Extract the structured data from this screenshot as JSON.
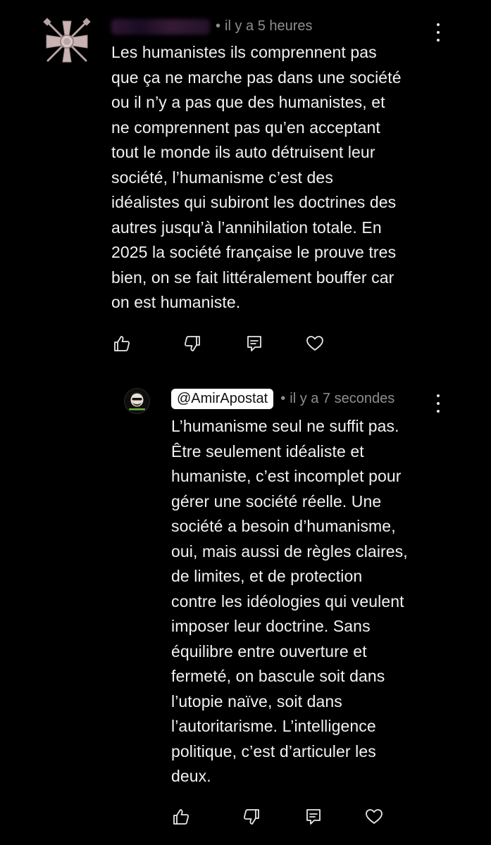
{
  "comments": [
    {
      "author_blurred": true,
      "timestamp": "il y a 5 heures",
      "separator": "•",
      "text": "Les humanistes ils comprennent pas\nque ça ne marche pas dans une société\nou il n’y a pas que des humanistes, et\nne comprennent pas qu’en acceptant\ntout le monde ils auto détruisent leur\nsociété, l’humanisme c’est des\nidéalistes qui subiront les doctrines des\nautres jusqu’à l’annihilation totale. En\n2025 la société française le prouve tres\nbien, on se fait littéralement bouffer car\non est humaniste.",
      "avatar_icon": "war-cross-medal-icon"
    },
    {
      "author": "@AmirApostat",
      "timestamp": "il y a 7 secondes",
      "separator": "•",
      "text": "L’humanisme seul ne suffit pas.\nÊtre seulement idéaliste et\nhumaniste, c’est incomplet pour\ngérer une société réelle. Une\nsociété a besoin d’humanisme,\noui, mais aussi de règles claires,\nde limites, et de protection\ncontre les idéologies qui veulent\nimposer leur doctrine. Sans\néquilibre entre ouverture et\nfermeté, on bascule soit dans\nl’utopie naïve, soit dans\nl’autoritarisme. L’intelligence\npolitique, c’est d’articuler les\ndeux.",
      "avatar_icon": "profile-avatar-icon"
    }
  ],
  "actions": {
    "like_icon": "thumbs-up-icon",
    "dislike_icon": "thumbs-down-icon",
    "reply_icon": "reply-icon",
    "heart_icon": "heart-icon",
    "more_icon": "more-options-icon"
  },
  "colors": {
    "background": "#000000",
    "text": "#f2f2f2",
    "meta": "#8e8e8e",
    "icon": "#e8e8e8"
  }
}
